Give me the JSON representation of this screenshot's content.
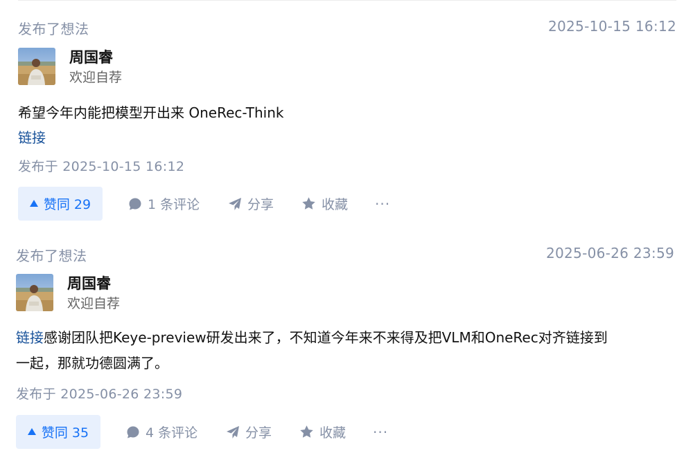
{
  "posts": [
    {
      "action_type": "发布了想法",
      "time": "2025-10-15 16:12",
      "author": {
        "name": "周国睿",
        "bio": "欢迎自荐"
      },
      "content_text": "希望今年内能把模型开出来 OneRec-Think",
      "link_label": "链接",
      "published": "发布于 2025-10-15 16:12",
      "vote_label": "赞同 29",
      "comment_label": "1 条评论",
      "share_label": "分享",
      "fav_label": "收藏",
      "more_label": "···"
    },
    {
      "action_type": "发布了想法",
      "time": "2025-06-26 23:59",
      "author": {
        "name": "周国睿",
        "bio": "欢迎自荐"
      },
      "link_label": "链接",
      "content_line1": "感谢团队把Keye-preview研发出来了，不知道今年来不来得及把VLM和OneRec对齐链接到",
      "content_line2": "一起，那就功德圆满了。",
      "published": "发布于 2025-06-26 23:59",
      "vote_label": "赞同 35",
      "comment_label": "4 条评论",
      "share_label": "分享",
      "fav_label": "收藏",
      "more_label": "···"
    }
  ],
  "icons": {
    "vote": "triangle-up-icon",
    "comment": "comment-bubble-icon",
    "share": "paper-plane-icon",
    "favorite": "star-icon",
    "more": "ellipsis-icon"
  },
  "colors": {
    "link": "#175199",
    "meta": "#8590a6",
    "vote_bg": "#e8f0fd",
    "vote_fg": "#1772f6",
    "text": "#121212"
  }
}
